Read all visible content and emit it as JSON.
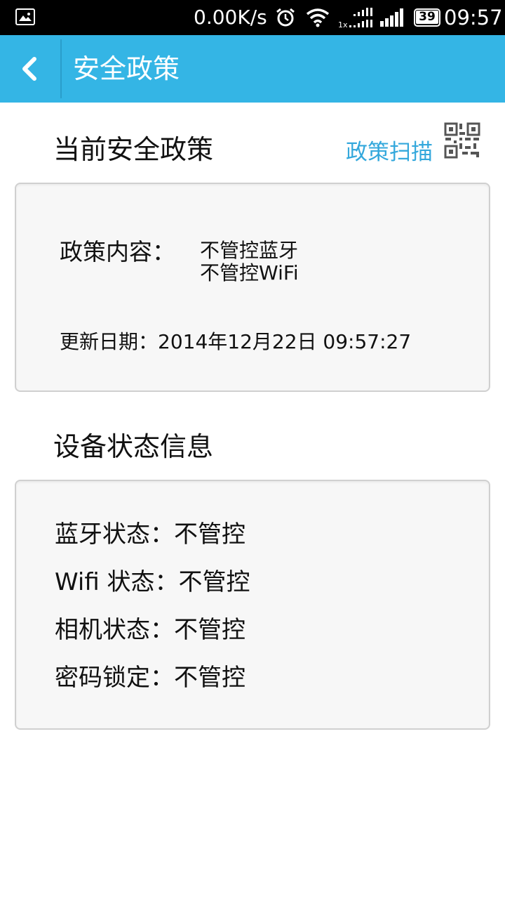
{
  "status_bar": {
    "net_speed": "0.00K/s",
    "net_type": "1x",
    "battery": "39",
    "time": "09:57",
    "icons": [
      "image-icon",
      "alarm-icon",
      "wifi-icon",
      "network-activity-icon",
      "signal-icon",
      "battery-icon"
    ]
  },
  "app_bar": {
    "title": "安全政策",
    "back_icon": "chevron-left-icon",
    "color": "#34b5e5"
  },
  "policy_section": {
    "title": "当前安全政策",
    "scan_label": "政策扫描",
    "scan_icon": "qr-code-icon",
    "content_label": "政策内容：",
    "content_items": [
      "不管控蓝牙",
      "不管控WiFi"
    ],
    "update_line": "更新日期：2014年12月22日 09:57:27"
  },
  "device_section": {
    "title": "设备状态信息",
    "rows": [
      "蓝牙状态：不管控",
      "Wifi 状态：不管控",
      "相机状态：不管控",
      "密码锁定：不管控"
    ]
  },
  "colors": {
    "accent": "#34b5e5",
    "link": "#34a8dc",
    "card_bg": "#f7f7f7",
    "card_border": "#d0d0d0"
  }
}
